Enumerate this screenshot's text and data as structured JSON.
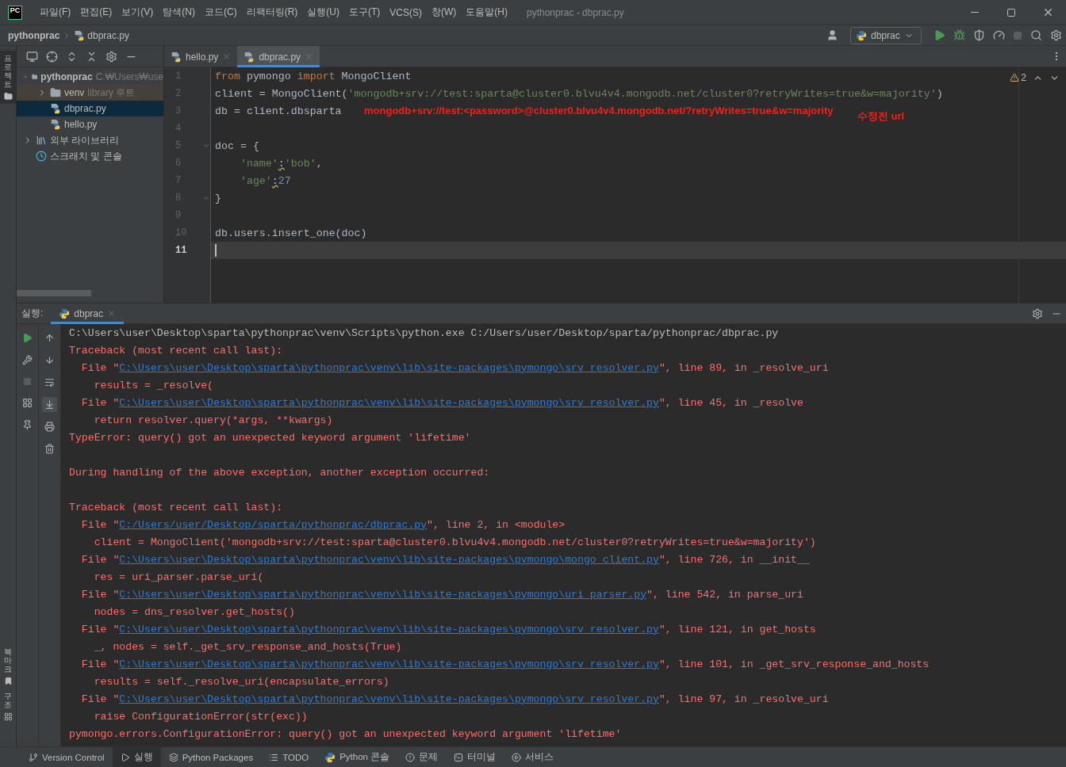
{
  "title_bar": {
    "logo": "PC",
    "menus": [
      "파일(F)",
      "편집(E)",
      "보기(V)",
      "탐색(N)",
      "코드(C)",
      "리팩터링(R)",
      "실행(U)",
      "도구(T)",
      "VCS(S)",
      "창(W)",
      "도움말(H)"
    ],
    "title": "pythonprac - dbprac.py"
  },
  "nav_bar": {
    "breadcrumb": [
      "pythonprac",
      "dbprac.py"
    ],
    "run_config": "dbprac"
  },
  "side_stripe": {
    "top": [
      {
        "label": "프로젝트",
        "selected": true
      }
    ],
    "bottom": [
      {
        "label": "북마크",
        "selected": false
      },
      {
        "label": "구조",
        "selected": false
      }
    ]
  },
  "project_tree": [
    {
      "label": "pythonprac",
      "hint": "C:₩Users₩use",
      "kind": "folder",
      "expanded": true,
      "selected": false,
      "children": [
        {
          "label": "venv",
          "hint": "library 루트",
          "kind": "library_folder",
          "expanded": false,
          "selected": false
        },
        {
          "label": "dbprac.py",
          "kind": "file",
          "selected": true
        },
        {
          "label": "hello.py",
          "kind": "file",
          "selected": false
        }
      ]
    },
    {
      "label": "외부 라이브러리",
      "kind": "libraries",
      "expanded": false,
      "selected": false
    },
    {
      "label": "스크래치 및 콘솔",
      "kind": "scratches",
      "selected": false
    }
  ],
  "editor": {
    "tabs": [
      {
        "label": "hello.py",
        "selected": false
      },
      {
        "label": "dbprac.py",
        "selected": true
      }
    ],
    "warnings": "2",
    "lines": [
      {
        "n": "1",
        "current": false,
        "fold_start": false,
        "fold_end": false,
        "tokens": [
          {
            "kind": "keyword",
            "text": "from"
          },
          {
            "kind": "plain",
            "text": " pymongo "
          },
          {
            "kind": "keyword",
            "text": "import"
          },
          {
            "kind": "plain",
            "text": " MongoClient"
          }
        ]
      },
      {
        "n": "2",
        "current": false,
        "fold_start": false,
        "fold_end": false,
        "tokens": [
          {
            "kind": "plain",
            "text": "client = MongoClient("
          },
          {
            "kind": "string",
            "text": "'mongodb+srv://test:sparta@cluster0.blvu4v4.mongodb.net/cluster0?retryWrites=true&w=majority'"
          },
          {
            "kind": "plain",
            "text": ")"
          }
        ]
      },
      {
        "n": "3",
        "current": false,
        "fold_start": false,
        "fold_end": false,
        "tokens": [
          {
            "kind": "plain",
            "text": "db = client.dbsparta"
          }
        ]
      },
      {
        "n": "4",
        "current": false,
        "fold_start": false,
        "fold_end": false
      },
      {
        "n": "5",
        "current": false,
        "fold_start": true,
        "fold_end": false,
        "tokens": [
          {
            "kind": "plain",
            "text": "doc = {"
          }
        ]
      },
      {
        "n": "6",
        "current": false,
        "fold_start": false,
        "fold_end": false,
        "tokens": [
          {
            "kind": "string",
            "text": "    'name'"
          },
          {
            "kind": "warn",
            "text": ":"
          },
          {
            "kind": "string",
            "text": "'bob'"
          },
          {
            "kind": "plain",
            "text": ","
          }
        ]
      },
      {
        "n": "7",
        "current": false,
        "fold_start": false,
        "fold_end": false,
        "tokens": [
          {
            "kind": "string",
            "text": "    'age'"
          },
          {
            "kind": "warn",
            "text": ":"
          },
          {
            "kind": "number",
            "text": "27"
          }
        ]
      },
      {
        "n": "8",
        "current": false,
        "fold_start": false,
        "fold_end": true,
        "tokens": [
          {
            "kind": "plain",
            "text": "}"
          }
        ]
      },
      {
        "n": "9",
        "current": false,
        "fold_start": false,
        "fold_end": false
      },
      {
        "n": "10",
        "current": false,
        "fold_start": false,
        "fold_end": false,
        "tokens": [
          {
            "kind": "plain",
            "text": "db.users.insert_one(doc)"
          }
        ]
      },
      {
        "n": "11",
        "current": true,
        "fold_start": false,
        "fold_end": false
      }
    ],
    "annotations": [
      "mongodb+srv://test:<password>@cluster0.blvu4v4.mongodb.net/?retryWrites=true&w=majority",
      "수정전 url"
    ]
  },
  "run_panel": {
    "label": "실행:",
    "tabs": [
      {
        "label": "dbprac",
        "selected": true
      }
    ],
    "lines": [
      {
        "kind": "text",
        "segments": [
          {
            "kind": "plain",
            "text": "C:\\Users\\user\\Desktop\\sparta\\pythonprac\\venv\\Scripts\\python.exe C:/Users/user/Desktop/sparta/pythonprac/dbprac.py"
          }
        ]
      },
      {
        "kind": "text",
        "segments": [
          {
            "kind": "error",
            "text": "Traceback (most recent call last):"
          }
        ]
      },
      {
        "kind": "text",
        "segments": [
          {
            "kind": "error",
            "text": "  File \""
          },
          {
            "kind": "link",
            "text": "C:\\Users\\user\\Desktop\\sparta\\pythonprac\\venv\\lib\\site-packages\\pymongo\\srv_resolver.py"
          },
          {
            "kind": "error",
            "text": "\", line 89, in _resolve_uri"
          }
        ]
      },
      {
        "kind": "text",
        "segments": [
          {
            "kind": "error",
            "text": "    results = _resolve("
          }
        ]
      },
      {
        "kind": "text",
        "segments": [
          {
            "kind": "error",
            "text": "  File \""
          },
          {
            "kind": "link",
            "text": "C:\\Users\\user\\Desktop\\sparta\\pythonprac\\venv\\lib\\site-packages\\pymongo\\srv_resolver.py"
          },
          {
            "kind": "error",
            "text": "\", line 45, in _resolve"
          }
        ]
      },
      {
        "kind": "text",
        "segments": [
          {
            "kind": "error",
            "text": "    return resolver.query(*args, **kwargs)"
          }
        ]
      },
      {
        "kind": "text",
        "segments": [
          {
            "kind": "error",
            "text": "TypeError: query() got an unexpected keyword argument 'lifetime'"
          }
        ]
      },
      {
        "kind": "blank"
      },
      {
        "kind": "text",
        "segments": [
          {
            "kind": "error",
            "text": "During handling of the above exception, another exception occurred:"
          }
        ]
      },
      {
        "kind": "blank"
      },
      {
        "kind": "text",
        "segments": [
          {
            "kind": "error",
            "text": "Traceback (most recent call last):"
          }
        ]
      },
      {
        "kind": "text",
        "segments": [
          {
            "kind": "error",
            "text": "  File \""
          },
          {
            "kind": "link",
            "text": "C:/Users/user/Desktop/sparta/pythonprac/dbprac.py"
          },
          {
            "kind": "error",
            "text": "\", line 2, in <module>"
          }
        ]
      },
      {
        "kind": "text",
        "segments": [
          {
            "kind": "error",
            "text": "    client = MongoClient('mongodb+srv://test:sparta@cluster0.blvu4v4.mongodb.net/cluster0?retryWrites=true&w=majority')"
          }
        ]
      },
      {
        "kind": "text",
        "segments": [
          {
            "kind": "error",
            "text": "  File \""
          },
          {
            "kind": "link",
            "text": "C:\\Users\\user\\Desktop\\sparta\\pythonprac\\venv\\lib\\site-packages\\pymongo\\mongo_client.py"
          },
          {
            "kind": "error",
            "text": "\", line 726, in __init__"
          }
        ]
      },
      {
        "kind": "text",
        "segments": [
          {
            "kind": "error",
            "text": "    res = uri_parser.parse_uri("
          }
        ]
      },
      {
        "kind": "text",
        "segments": [
          {
            "kind": "error",
            "text": "  File \""
          },
          {
            "kind": "link",
            "text": "C:\\Users\\user\\Desktop\\sparta\\pythonprac\\venv\\lib\\site-packages\\pymongo\\uri_parser.py"
          },
          {
            "kind": "error",
            "text": "\", line 542, in parse_uri"
          }
        ]
      },
      {
        "kind": "text",
        "segments": [
          {
            "kind": "error",
            "text": "    nodes = dns_resolver.get_hosts()"
          }
        ]
      },
      {
        "kind": "text",
        "segments": [
          {
            "kind": "error",
            "text": "  File \""
          },
          {
            "kind": "link",
            "text": "C:\\Users\\user\\Desktop\\sparta\\pythonprac\\venv\\lib\\site-packages\\pymongo\\srv_resolver.py"
          },
          {
            "kind": "error",
            "text": "\", line 121, in get_hosts"
          }
        ]
      },
      {
        "kind": "text",
        "segments": [
          {
            "kind": "error",
            "text": "    _, nodes = self._get_srv_response_and_hosts(True)"
          }
        ]
      },
      {
        "kind": "text",
        "segments": [
          {
            "kind": "error",
            "text": "  File \""
          },
          {
            "kind": "link",
            "text": "C:\\Users\\user\\Desktop\\sparta\\pythonprac\\venv\\lib\\site-packages\\pymongo\\srv_resolver.py"
          },
          {
            "kind": "error",
            "text": "\", line 101, in _get_srv_response_and_hosts"
          }
        ]
      },
      {
        "kind": "text",
        "segments": [
          {
            "kind": "error",
            "text": "    results = self._resolve_uri(encapsulate_errors)"
          }
        ]
      },
      {
        "kind": "text",
        "segments": [
          {
            "kind": "error",
            "text": "  File \""
          },
          {
            "kind": "link",
            "text": "C:\\Users\\user\\Desktop\\sparta\\pythonprac\\venv\\lib\\site-packages\\pymongo\\srv_resolver.py"
          },
          {
            "kind": "error",
            "text": "\", line 97, in _resolve_uri"
          }
        ]
      },
      {
        "kind": "text",
        "segments": [
          {
            "kind": "error",
            "text": "    raise ConfigurationError(str(exc))"
          }
        ]
      },
      {
        "kind": "text",
        "segments": [
          {
            "kind": "error",
            "text": "pymongo.errors.ConfigurationError: query() got an unexpected keyword argument 'lifetime'"
          }
        ]
      }
    ]
  },
  "status_bar": [
    {
      "label": "Version Control",
      "kind": "vcs",
      "selected": false
    },
    {
      "label": "실행",
      "kind": "run",
      "selected": true
    },
    {
      "label": "Python Packages",
      "kind": "packages",
      "selected": false
    },
    {
      "label": "TODO",
      "kind": "todo",
      "selected": false
    },
    {
      "label": "Python 콘솔",
      "kind": "console",
      "selected": false
    },
    {
      "label": "문제",
      "kind": "problems",
      "selected": false
    },
    {
      "label": "터미널",
      "kind": "terminal",
      "selected": false
    },
    {
      "label": "서비스",
      "kind": "services",
      "selected": false
    }
  ]
}
